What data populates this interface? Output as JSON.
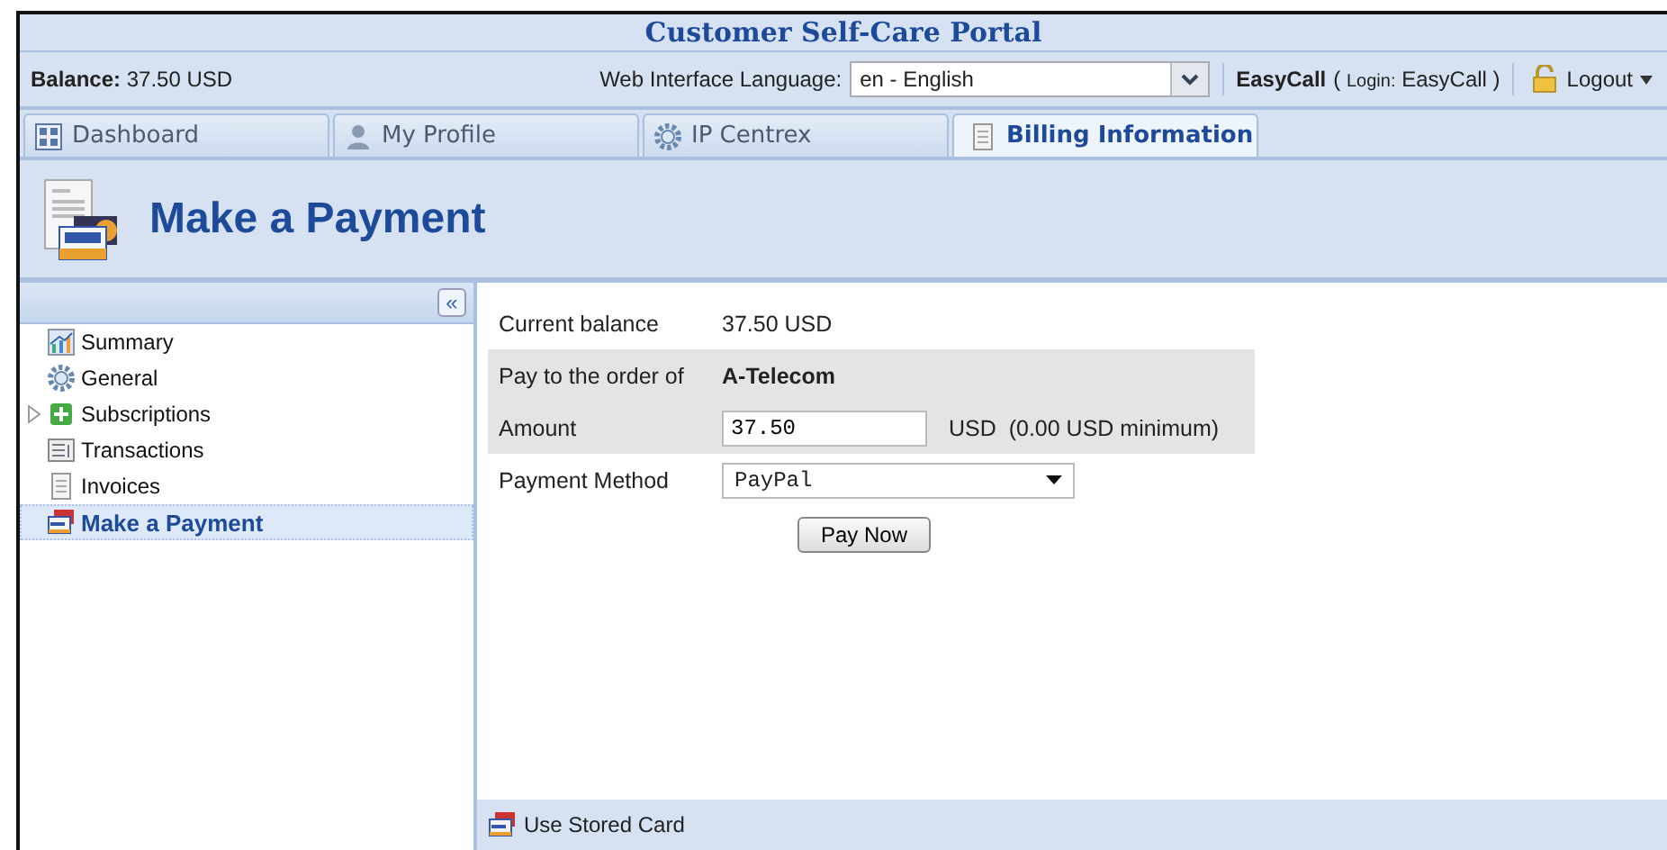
{
  "window": {
    "title": "Customer Self-Care Portal"
  },
  "info_bar": {
    "balance_label": "Balance:",
    "balance_value": "37.50 USD",
    "language_label": "Web Interface Language:",
    "language_value": "en - English",
    "account_name": "EasyCall",
    "login_open": "(",
    "login_label": "Login:",
    "login_value": "EasyCall",
    "login_close": ")",
    "logout": "Logout"
  },
  "tabs": [
    {
      "label": "Dashboard",
      "kind": "dashboard",
      "selected": false
    },
    {
      "label": "My Profile",
      "kind": "person",
      "selected": false
    },
    {
      "label": "IP Centrex",
      "kind": "gear",
      "selected": false
    },
    {
      "label": "Billing Information",
      "kind": "document",
      "selected": true
    }
  ],
  "page_header": {
    "title": "Make a Payment"
  },
  "sidebar": {
    "collapse": "«",
    "items": [
      {
        "label": "Summary",
        "kind": "chart",
        "selected": false
      },
      {
        "label": "General",
        "kind": "gear",
        "selected": false
      },
      {
        "label": "Subscriptions",
        "kind": "subscriptions",
        "expanded": false,
        "selected": false
      },
      {
        "label": "Transactions",
        "kind": "list",
        "selected": false
      },
      {
        "label": "Invoices",
        "kind": "document",
        "selected": false
      },
      {
        "label": "Make a Payment",
        "kind": "card",
        "selected": true
      }
    ]
  },
  "form": {
    "rows": [
      {
        "label": "Current balance",
        "kind": "text",
        "value": "37.50 USD",
        "shaded": false
      },
      {
        "label": "Pay to the order of",
        "kind": "bold",
        "value": "A-Telecom",
        "shaded": true
      },
      {
        "label": "Amount",
        "kind": "input",
        "value": "37.50",
        "note": "USD  (0.00 USD minimum)",
        "shaded": true
      },
      {
        "label": "Payment Method",
        "kind": "select",
        "value": "PayPal",
        "shaded": false
      }
    ],
    "submit": "Pay Now"
  },
  "footer": {
    "action": "Use Stored Card"
  }
}
